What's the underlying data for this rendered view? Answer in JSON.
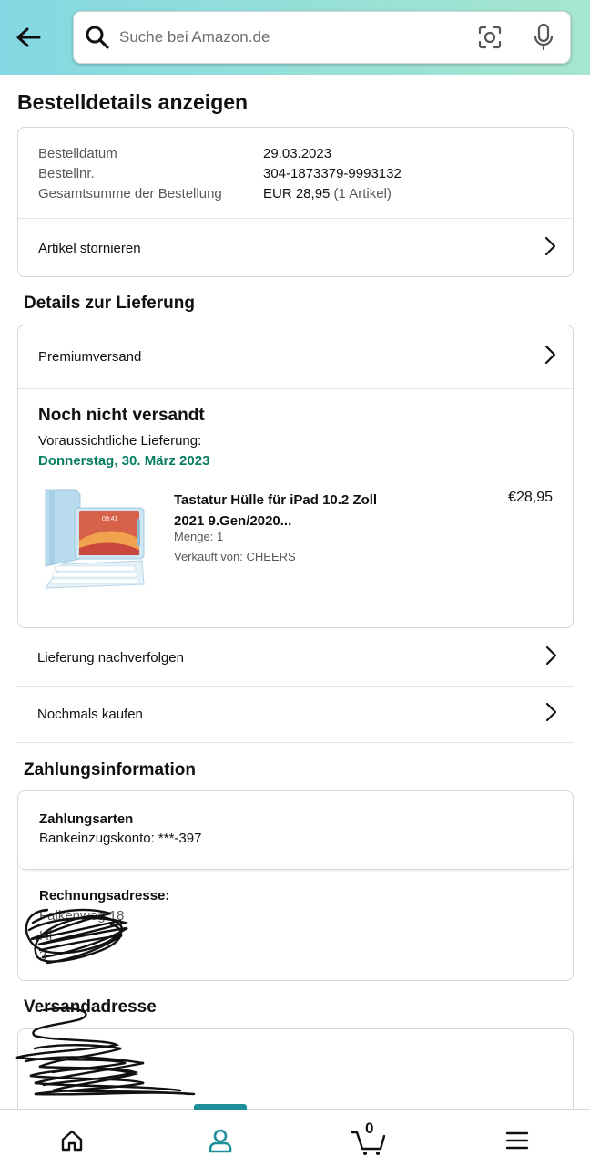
{
  "search": {
    "placeholder": "Suche bei Amazon.de"
  },
  "page_title": "Bestelldetails anzeigen",
  "order": {
    "date_label": "Bestelldatum",
    "date_value": "29.03.2023",
    "number_label": "Bestellnr.",
    "number_value": "304-1873379-9993132",
    "total_label": "Gesamtsumme der Bestellung",
    "total_value": "EUR 28,95",
    "total_items": "(1 Artikel)",
    "cancel_label": "Artikel stornieren"
  },
  "delivery": {
    "heading": "Details zur Lieferung",
    "shipping_method": "Premiumversand",
    "status": "Noch nicht versandt",
    "expected_label": "Voraussichtliche Lieferung:",
    "expected_date": "Donnerstag, 30. März 2023",
    "product": {
      "title_line1": "Tastatur Hülle für iPad 10.2 Zoll",
      "title_line2": "2021 9.Gen/2020...",
      "price": "€28,95",
      "quantity": "Menge: 1",
      "seller": "Verkauft von: CHEERS",
      "screen_time": "09:41"
    },
    "track_label": "Lieferung nachverfolgen",
    "buy_again_label": "Nochmals kaufen"
  },
  "payment": {
    "heading": "Zahlungsinformation",
    "methods_label": "Zahlungsarten",
    "account": "Bankeinzugskonto: ***-397",
    "billing_label": "Rechnungsadresse:",
    "billing_line1": "Falkenweg 18",
    "billing_line2": "Hi",
    "billing_line3": "3"
  },
  "shipping_address": {
    "heading": "Versandadresse"
  },
  "cart_count": "0",
  "colors": {
    "header_start": "#84d8e3",
    "header_end": "#a6e6ce",
    "green": "#067d62",
    "active_tab": "#1e8f9a"
  },
  "icons": [
    "back-arrow-icon",
    "search-icon",
    "camera-icon",
    "mic-icon",
    "chevron-right-icon",
    "home-icon",
    "profile-icon",
    "cart-icon",
    "menu-icon"
  ]
}
